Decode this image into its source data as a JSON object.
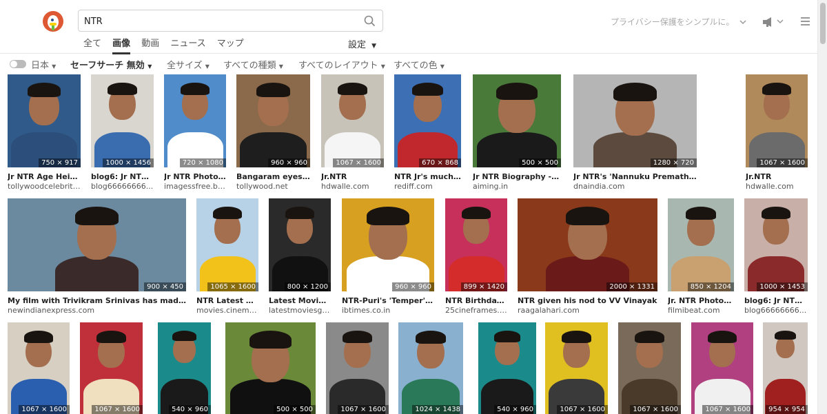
{
  "search": {
    "query": "NTR"
  },
  "tabs": [
    "全て",
    "画像",
    "動画",
    "ニュース",
    "マップ"
  ],
  "active_tab": 1,
  "settings_label": "設定",
  "privacy_text": "プライバシー保護をシンプルに。",
  "filters": {
    "region": "日本",
    "safe_search": "セーフサーチ 無効",
    "size": "全サイズ",
    "type": "すべての種類",
    "layout": "すべてのレイアウト",
    "color": "すべての色"
  },
  "rows": [
    [
      {
        "title": "Jr NTR Age Heig...",
        "source": "tollywoodcelebriti...",
        "dims": "750 × 917",
        "bg": "#2f5a8a",
        "body": "#2c4e7a"
      },
      {
        "title": "blog6: Jr NTR ...",
        "source": "blog66666666...",
        "dims": "1000 × 1456",
        "bg": "#d9d6d0",
        "body": "#3a6db0"
      },
      {
        "title": "Jr NTR Photos...",
        "source": "imagessfree.blo...",
        "dims": "720 × 1080",
        "bg": "#4f8cc9",
        "body": "#ffffff"
      },
      {
        "title": "Bangaram eyes m...",
        "source": "tollywood.net",
        "dims": "960 × 960",
        "bg": "#8a6a4a",
        "body": "#1e1e1e"
      },
      {
        "title": "Jr.NTR",
        "source": "hdwalle.com",
        "dims": "1067 × 1600",
        "bg": "#c8c3b8",
        "body": "#f5f5f5"
      },
      {
        "title": "NTR Jr's much a...",
        "source": "rediff.com",
        "dims": "670 × 868",
        "bg": "#3d6fb5",
        "body": "#c0282d"
      },
      {
        "title": "Jr NTR Biography - W...",
        "source": "aiming.in",
        "dims": "500 × 500",
        "bg": "#4a7a3a",
        "body": "#1a1a1a"
      },
      {
        "title": "Jr NTR's 'Nannuku Prematho' is a big tick...",
        "source": "dnaindia.com",
        "dims": "1280 × 720",
        "bg": "#b5b5b5",
        "body": "#5c4a3e"
      },
      {
        "title": "Jr.NTR",
        "source": "hdwalle.com",
        "dims": "1067 × 1600",
        "bg": "#b08a5a",
        "body": "#6b6b6b"
      }
    ],
    [
      {
        "title": "My film with Trivikram Srinivas has made me ...",
        "source": "newindianexpress.com",
        "dims": "900 × 450",
        "bg": "#6b8aa0",
        "body": "#3a2a2a"
      },
      {
        "title": "NTR Latest H...",
        "source": "movies.cinema...",
        "dims": "1065 × 1600",
        "bg": "#b7d1e6",
        "body": "#f2c21b"
      },
      {
        "title": "Latest Movies ...",
        "source": "latestmoviesgal...",
        "dims": "800 × 1200",
        "bg": "#2a2a2a",
        "body": "#111111"
      },
      {
        "title": "NTR-Puri's 'Temper' A...",
        "source": "ibtimes.co.in",
        "dims": "960 × 960",
        "bg": "#d8a020",
        "body": "#ffffff"
      },
      {
        "title": "NTR Birthday ...",
        "source": "25cineframes.c...",
        "dims": "899 × 1420",
        "bg": "#c6305a",
        "body": "#d42b2b"
      },
      {
        "title": "NTR given his nod to VV Vinayak",
        "source": "raagalahari.com",
        "dims": "2000 × 1331",
        "bg": "#8a3a1a",
        "body": "#6b1a1a"
      },
      {
        "title": "Jr. NTR Photos ...",
        "source": "filmibeat.com",
        "dims": "850 × 1204",
        "bg": "#a8b8b0",
        "body": "#c9a070"
      },
      {
        "title": "blog6: Jr NTR I...",
        "source": "blog66666666...",
        "dims": "1000 × 1453",
        "bg": "#c8b0a8",
        "body": "#8a2a2a"
      }
    ],
    [
      {
        "dims": "1067 × 1600",
        "bg": "#d6cfc2",
        "body": "#2a5fb0"
      },
      {
        "dims": "1067 × 1600",
        "bg": "#c0303a",
        "body": "#f0e0c0"
      },
      {
        "dims": "540 × 960",
        "bg": "#1a8a8a",
        "body": "#1a1a1a"
      },
      {
        "dims": "500 × 500",
        "bg": "#6a8a3a",
        "body": "#101010"
      },
      {
        "dims": "1067 × 1600",
        "bg": "#8a8a8a",
        "body": "#2a2a2a"
      },
      {
        "dims": "1024 × 1438",
        "bg": "#8ab0d0",
        "body": "#2a7a5a"
      },
      {
        "dims": "540 × 960",
        "bg": "#1a8a8a",
        "body": "#1a1a1a"
      },
      {
        "dims": "1067 × 1600",
        "bg": "#e0c020",
        "body": "#3a3a3a"
      },
      {
        "dims": "1067 × 1600",
        "bg": "#7a6a5a",
        "body": "#4a3a2a"
      },
      {
        "dims": "1067 × 1600",
        "bg": "#b04080",
        "body": "#f0f0f0"
      },
      {
        "dims": "954 × 954",
        "bg": "#d0c8c0",
        "body": "#a02020"
      }
    ]
  ]
}
